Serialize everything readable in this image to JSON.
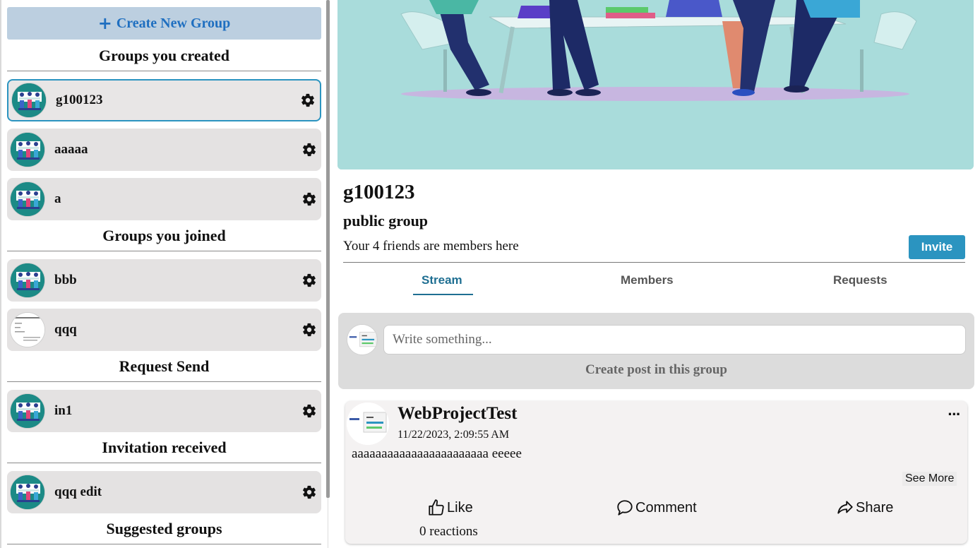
{
  "sidebar": {
    "create_button": {
      "icon": "plus-icon",
      "label": "Create New Group"
    },
    "sections": {
      "created": {
        "title": "Groups you created",
        "items": [
          {
            "name": "g100123",
            "avatar": "team-illustration",
            "active": true
          },
          {
            "name": "aaaaa",
            "avatar": "team-illustration"
          },
          {
            "name": "a",
            "avatar": "team-illustration"
          }
        ]
      },
      "joined": {
        "title": "Groups you joined",
        "items": [
          {
            "name": "bbb",
            "avatar": "team-illustration"
          },
          {
            "name": "qqq",
            "avatar": "document-thumbnail"
          }
        ]
      },
      "request_send": {
        "title": "Request Send",
        "items": [
          {
            "name": "in1",
            "avatar": "team-illustration"
          }
        ]
      },
      "invitation": {
        "title": "Invitation received",
        "items": [
          {
            "name": "qqq edit",
            "avatar": "team-illustration"
          }
        ]
      },
      "suggested": {
        "title": "Suggested groups"
      }
    },
    "item_action_icon": "gear-icon"
  },
  "group": {
    "name": "g100123",
    "privacy": "public group",
    "friends_text": "Your 4 friends are members here",
    "invite_label": "Invite",
    "tabs": [
      {
        "label": "Stream",
        "active": true
      },
      {
        "label": "Members"
      },
      {
        "label": "Requests"
      }
    ]
  },
  "composer": {
    "placeholder": "Write something...",
    "label": "Create post in this group"
  },
  "post": {
    "author": "WebProjectTest",
    "timestamp": "11/22/2023, 2:09:55 AM",
    "body": "aaaaaaaaaaaaaaaaaaaaaaa eeeee",
    "see_more": "See More",
    "more_icon": "...",
    "actions": {
      "like": "Like",
      "comment": "Comment",
      "share": "Share"
    },
    "reactions": "0 reactions"
  },
  "colors": {
    "accent": "#2b94c0",
    "create_button_bg": "#bccfe0",
    "create_button_text": "#1f6fc0",
    "item_bg": "#e4e2e2",
    "cover_bg": "#a9dcdb",
    "tab_active": "#1f6f92"
  }
}
